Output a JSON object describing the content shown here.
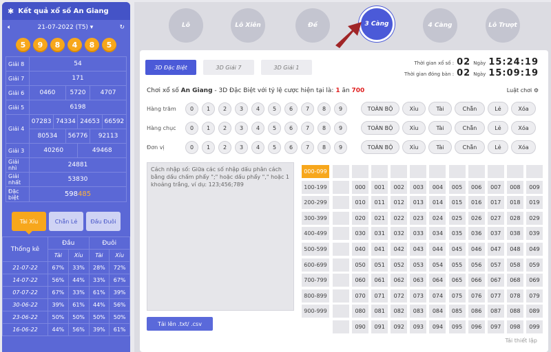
{
  "left": {
    "title": "Kết quả xổ số An Giang",
    "date": "21-07-2022 (T5)",
    "balls": [
      "5",
      "9",
      "8",
      "4",
      "8",
      "5"
    ],
    "results": [
      {
        "label": "Giải 8",
        "rows": [
          [
            "54"
          ]
        ]
      },
      {
        "label": "Giải 7",
        "rows": [
          [
            "171"
          ]
        ]
      },
      {
        "label": "Giải 6",
        "rows": [
          [
            "0460",
            "5720",
            "4707"
          ]
        ]
      },
      {
        "label": "Giải 5",
        "rows": [
          [
            "6198"
          ]
        ]
      },
      {
        "label": "Giải 4",
        "rows": [
          [
            "07283",
            "74334",
            "24653",
            "66592"
          ],
          [
            "80534",
            "56776",
            "92113"
          ]
        ]
      },
      {
        "label": "Giải 3",
        "rows": [
          [
            "40260",
            "49468"
          ]
        ]
      },
      {
        "label": "Giải nhì",
        "rows": [
          [
            "24881"
          ]
        ]
      },
      {
        "label": "Giải nhất",
        "rows": [
          [
            "53830"
          ]
        ]
      },
      {
        "label": "Đặc biệt",
        "special_prefix": "598",
        "special_suffix": "485"
      }
    ],
    "stat_tabs": [
      "Tài Xỉu",
      "Chẵn Lẻ",
      "Đầu Đuôi"
    ],
    "stats": {
      "title": "Thống kê",
      "head": "Đầu",
      "tail": "Đuôi",
      "tai": "Tài",
      "xiu": "Xỉu",
      "rows": [
        [
          "21-07-22",
          "67%",
          "33%",
          "28%",
          "72%"
        ],
        [
          "14-07-22",
          "56%",
          "44%",
          "33%",
          "67%"
        ],
        [
          "07-07-22",
          "67%",
          "33%",
          "61%",
          "39%"
        ],
        [
          "30-06-22",
          "39%",
          "61%",
          "44%",
          "56%"
        ],
        [
          "23-06-22",
          "50%",
          "50%",
          "50%",
          "50%"
        ],
        [
          "16-06-22",
          "44%",
          "56%",
          "39%",
          "61%"
        ]
      ]
    }
  },
  "modes": [
    "Lô",
    "Lô Xiên",
    "Đề",
    "3 Càng",
    "4 Càng",
    "Lô Trượt"
  ],
  "subtabs": [
    "3D Đặc Biệt",
    "3D Giải 7",
    "3D Giải 1"
  ],
  "timers": {
    "draw_label": "Thời gian xổ số :",
    "draw_days": "02",
    "draw_time": "15:24:19",
    "close_label": "Thời gian đóng bàn :",
    "close_days": "02",
    "close_time": "15:09:19",
    "days_unit": "Ngày"
  },
  "play": {
    "prefix": "Chơi xổ số ",
    "province": "An Giang",
    "mid": " - 3D Đặc Biệt với tỷ lệ cược hiện tại là: ",
    "odds_a": "1",
    "odds_sep": " ăn ",
    "odds_b": "700",
    "rules": "Luật chơi"
  },
  "digit_rows": [
    "Hàng trăm",
    "Hàng chục",
    "Đơn vị"
  ],
  "digits": [
    "0",
    "1",
    "2",
    "3",
    "4",
    "5",
    "6",
    "7",
    "8",
    "9"
  ],
  "quick": [
    "TOÀN BỘ",
    "Xỉu",
    "Tài",
    "Chẵn",
    "Lẻ",
    "Xóa"
  ],
  "input_hint": "Cách nhập số: Giữa các số nhập dấu phân cách bằng dấu chấm phẩy \";\" hoặc dấu phẩy \",\" hoặc 1 khoảng trắng, ví dụ: 123;456;789",
  "upload": "Tải lên .txt/ .csv",
  "ranges": [
    "000-099",
    "100-199",
    "200-299",
    "300-399",
    "400-499",
    "500-599",
    "600-699",
    "700-799",
    "800-899",
    "900-999"
  ],
  "reset": "Tái thiết lập",
  "colors": {
    "primary": "#4b5ad8",
    "accent": "#f7a71c",
    "odds": "#e02020"
  }
}
